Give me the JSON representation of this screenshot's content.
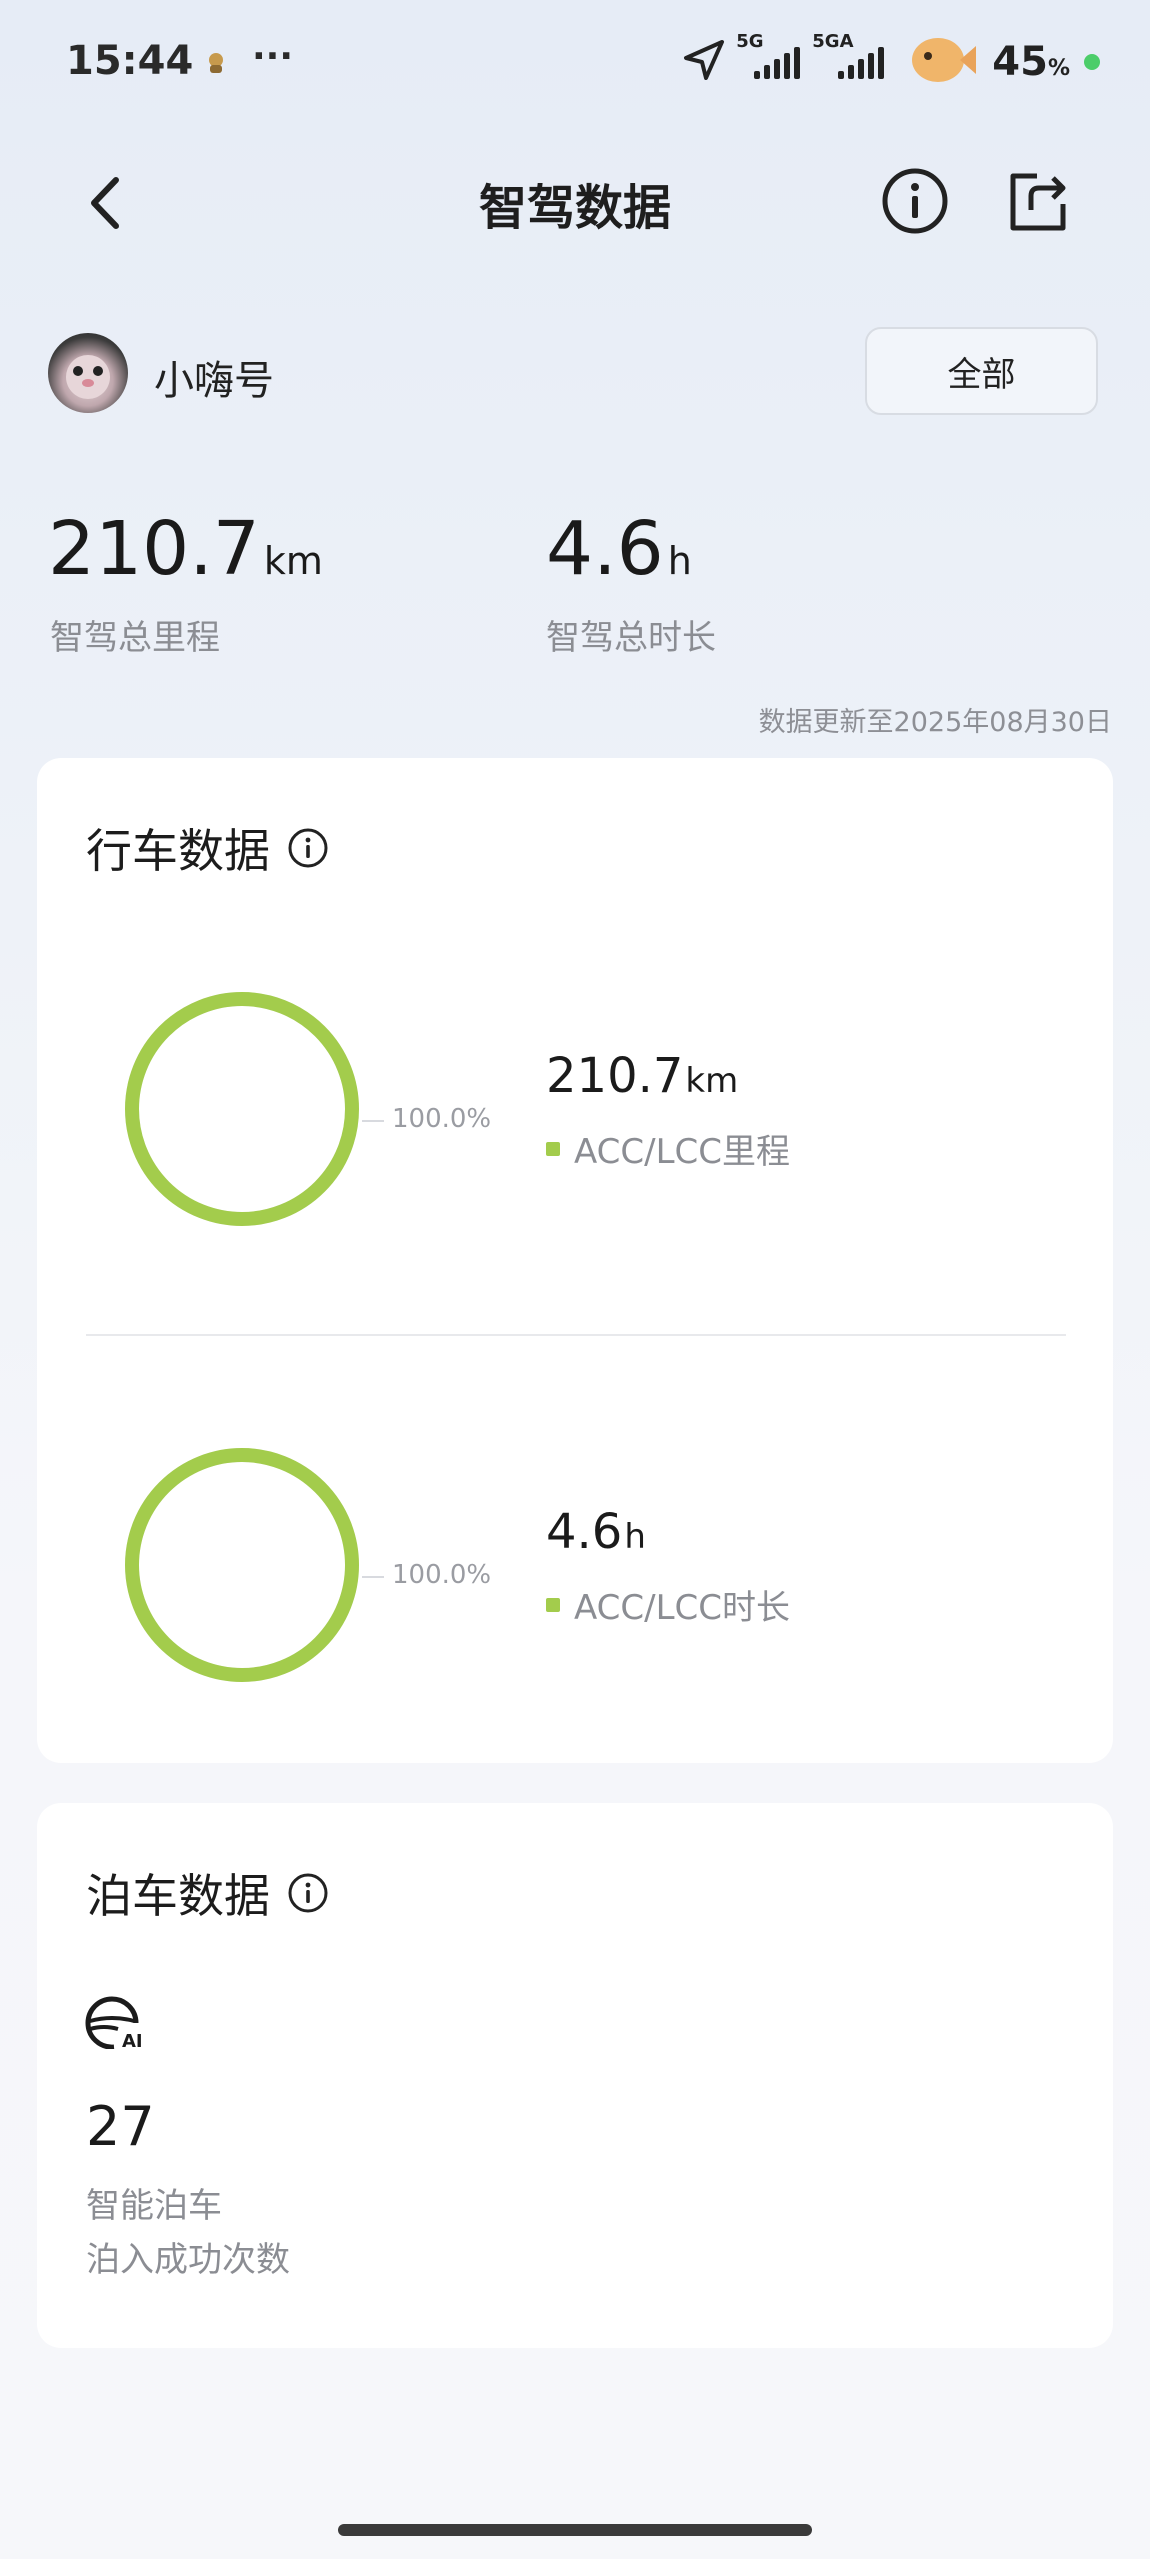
{
  "status_bar": {
    "time": "15:44",
    "more": "···",
    "net1": "5G",
    "net2": "5GA",
    "battery": "45",
    "battery_unit": "%"
  },
  "header": {
    "title": "智驾数据"
  },
  "user": {
    "name": "小嗨号",
    "filter_label": "全部"
  },
  "totals": {
    "distance_value": "210.7",
    "distance_unit": "km",
    "distance_label": "智驾总里程",
    "duration_value": "4.6",
    "duration_unit": "h",
    "duration_label": "智驾总时长"
  },
  "update_note": "数据更新至2025年08月30日",
  "driving": {
    "title": "行车数据",
    "mileage": {
      "percent": "100.0%",
      "value": "210.7",
      "unit": "km",
      "label": "ACC/LCC里程",
      "fraction": 1.0
    },
    "duration": {
      "percent": "100.0%",
      "value": "4.6",
      "unit": "h",
      "label": "ACC/LCC时长",
      "fraction": 1.0
    }
  },
  "parking": {
    "title": "泊车数据",
    "count": "27",
    "label1": "智能泊车",
    "label2": "泊入成功次数"
  },
  "colors": {
    "accent_green": "#a3cc4c",
    "status_dot": "#4ccd6a"
  },
  "icons": [
    "location-arrow-icon",
    "back-chevron-icon",
    "info-icon",
    "share-icon",
    "ai-parking-icon"
  ]
}
